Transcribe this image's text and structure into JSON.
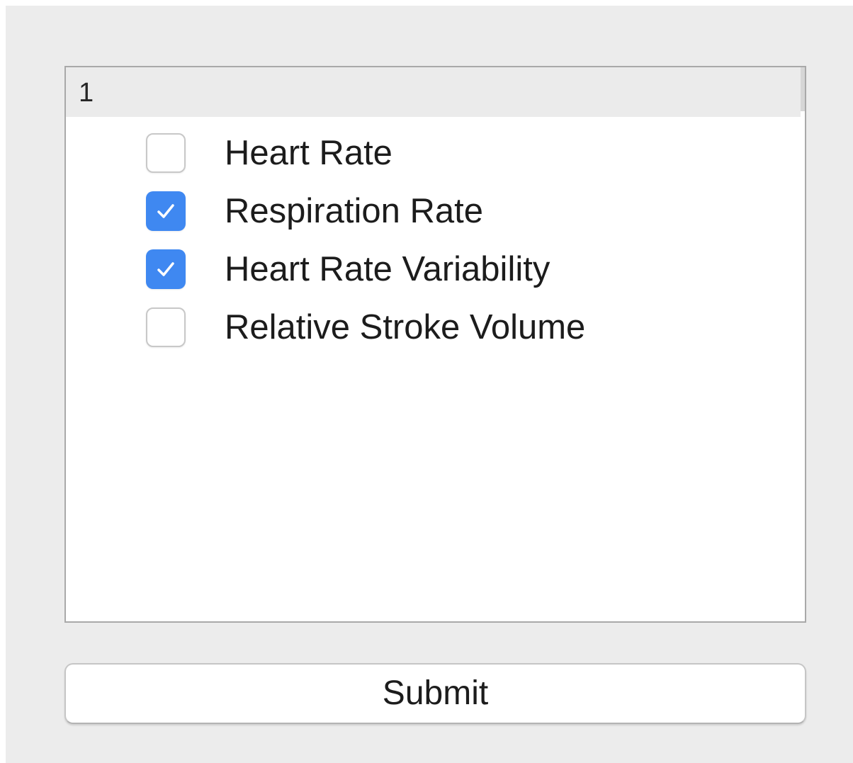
{
  "list": {
    "header": "1",
    "items": [
      {
        "label": "Heart Rate",
        "checked": false
      },
      {
        "label": "Respiration Rate",
        "checked": true
      },
      {
        "label": "Heart Rate Variability",
        "checked": true
      },
      {
        "label": "Relative Stroke Volume",
        "checked": false
      }
    ]
  },
  "submit": {
    "label": "Submit"
  },
  "colors": {
    "window_background": "#ececec",
    "checkbox_checked": "#3f88f1",
    "list_header_background": "#ebebeb"
  },
  "icons": {
    "checkmark": "checkmark-icon"
  }
}
